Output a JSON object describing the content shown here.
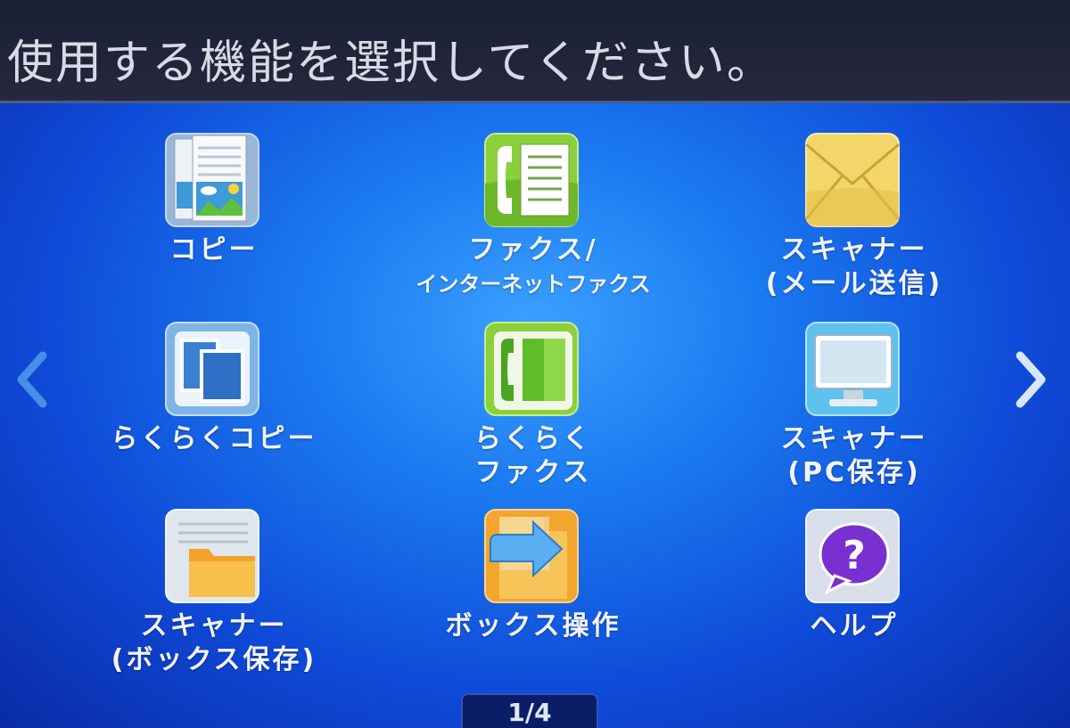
{
  "header": {
    "title": "使用する機能を選択してください。"
  },
  "nav": {
    "prev_icon": "chevron-left-icon",
    "next_icon": "chevron-right-icon"
  },
  "tiles": [
    {
      "line1": "コピー",
      "line2": "",
      "icon": "copy-icon"
    },
    {
      "line1": "ファクス/",
      "line2": "インターネットファクス",
      "icon": "fax-icon"
    },
    {
      "line1": "スキャナー",
      "line2": "(メール送信)",
      "icon": "envelope-icon"
    },
    {
      "line1": "らくらくコピー",
      "line2": "",
      "icon": "easy-copy-icon"
    },
    {
      "line1": "らくらく",
      "line2": "ファクス",
      "icon": "easy-fax-icon"
    },
    {
      "line1": "スキャナー",
      "line2": "(PC保存)",
      "icon": "monitor-icon"
    },
    {
      "line1": "スキャナー",
      "line2": "(ボックス保存)",
      "icon": "folder-icon"
    },
    {
      "line1": "ボックス操作",
      "line2": "",
      "icon": "box-arrow-icon"
    },
    {
      "line1": "ヘルプ",
      "line2": "",
      "icon": "help-icon"
    }
  ],
  "pager": {
    "text": "1/4"
  },
  "colors": {
    "header_bg": "#1f2236",
    "screen_blue": "#1b7af0",
    "label_text": "#f2f4fa"
  }
}
